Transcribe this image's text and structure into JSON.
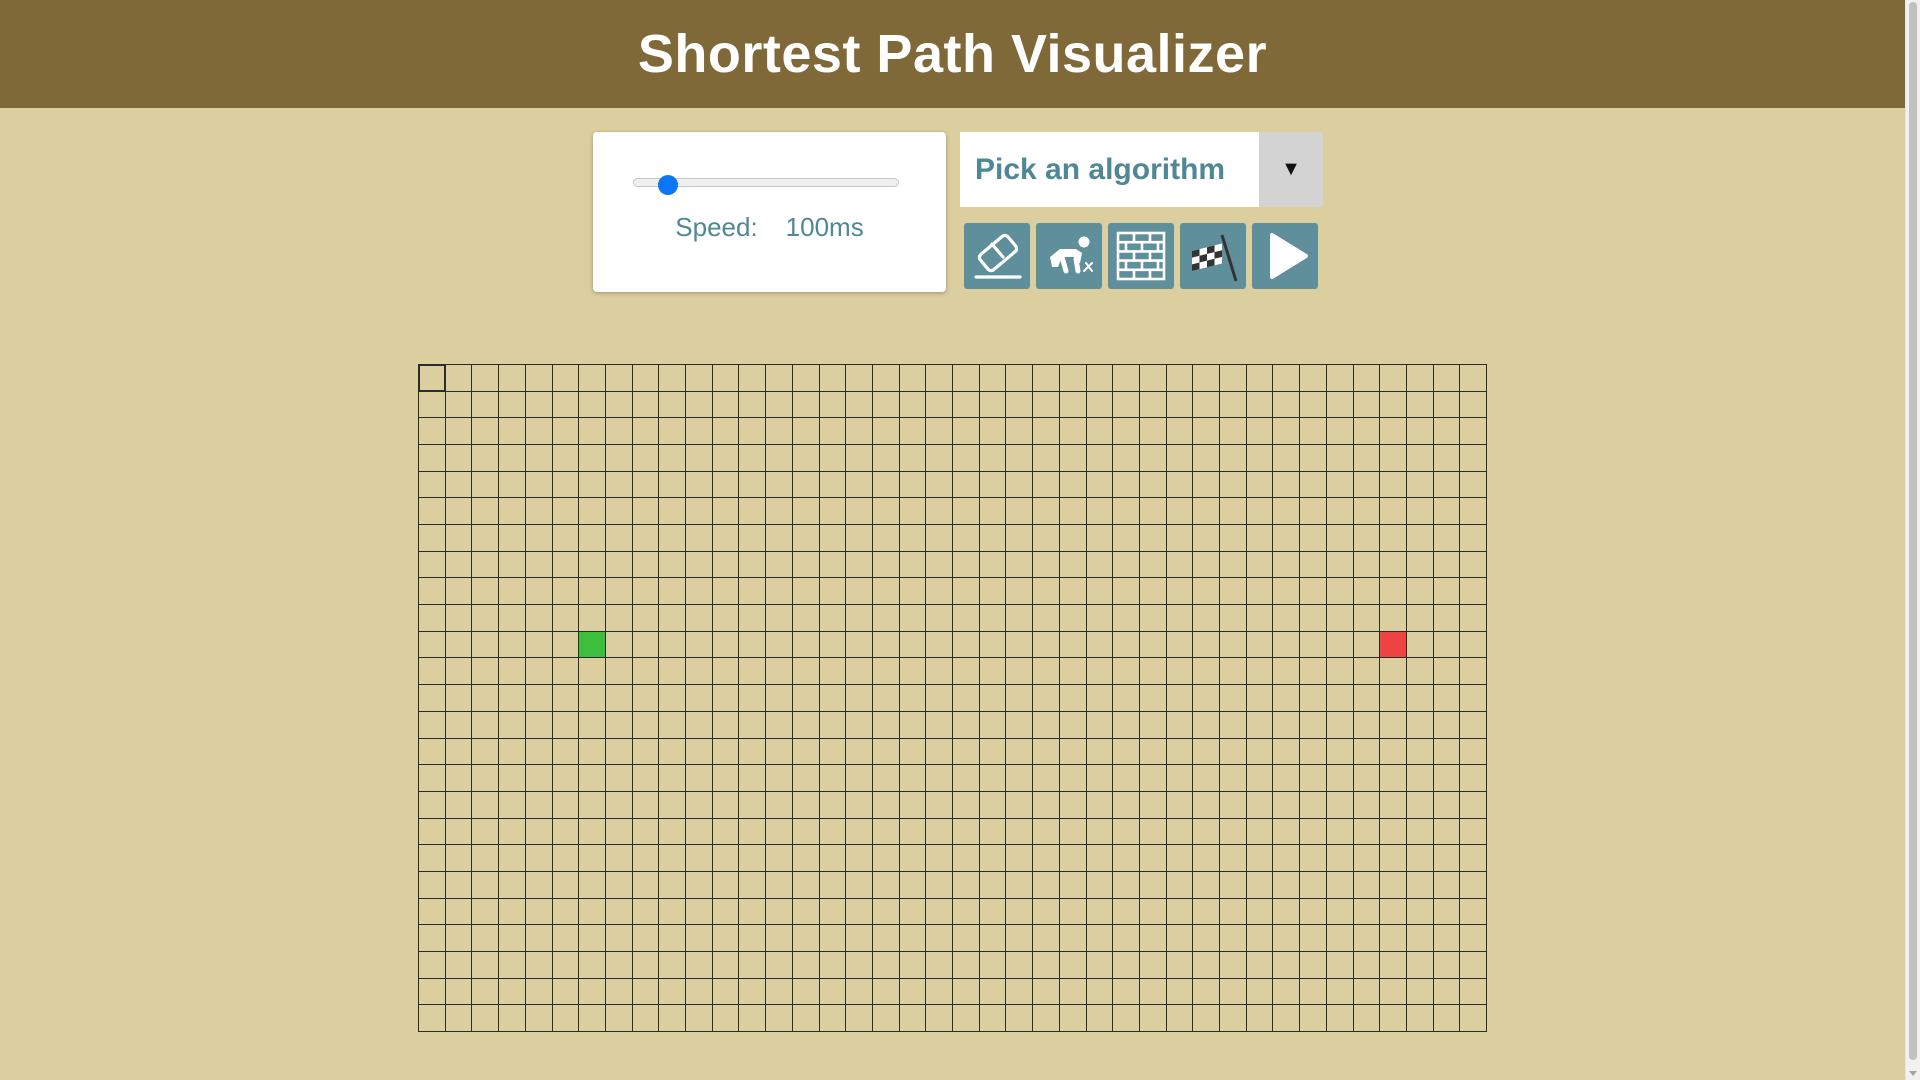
{
  "header": {
    "title": "Shortest Path Visualizer"
  },
  "speed": {
    "label": "Speed:",
    "value_text": "100ms",
    "slider_fraction": 0.1
  },
  "algorithm_select": {
    "selected": "Pick an algorithm",
    "arrow": "▼"
  },
  "toolbar": {
    "buttons": [
      {
        "icon": "eraser-icon"
      },
      {
        "icon": "crawling-person-icon"
      },
      {
        "icon": "brick-wall-icon"
      },
      {
        "icon": "checkered-flag-icon"
      },
      {
        "icon": "play-icon"
      }
    ]
  },
  "grid": {
    "columns": 40,
    "rows": 25,
    "start": {
      "row": 10,
      "col": 6
    },
    "end": {
      "row": 10,
      "col": 36
    },
    "colors": {
      "start": "#3dbf3d",
      "end": "#f04444",
      "line": "#2b2b2b"
    }
  },
  "theme": {
    "background": "#dccf9f",
    "header": "#806939",
    "accent": "#5f8f9a",
    "text_accent": "#4f8895",
    "slider_thumb": "#0b75f5"
  }
}
